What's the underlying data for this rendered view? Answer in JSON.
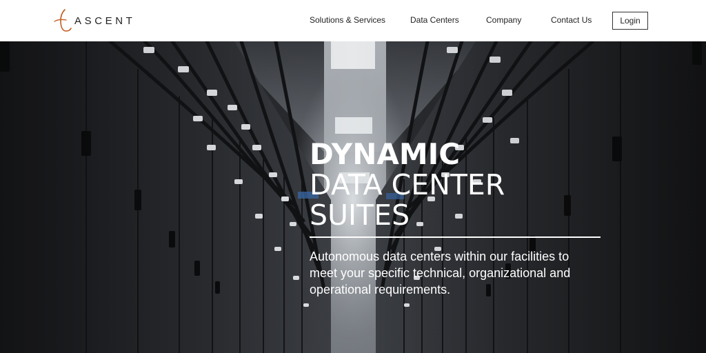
{
  "brand": {
    "name": "ASCENT",
    "accent_color": "#c25a1e"
  },
  "nav": {
    "items": [
      {
        "label": "Solutions & Services"
      },
      {
        "label": "Data Centers"
      },
      {
        "label": "Company"
      },
      {
        "label": "Contact Us"
      }
    ],
    "login_label": "Login"
  },
  "hero": {
    "title_line1": "DYNAMIC",
    "title_line2": "DATA CENTER",
    "title_line3": "SUITES",
    "subtitle": "Autonomous data centers within our facilities to meet your specific technical, organizational and operational requirements."
  }
}
